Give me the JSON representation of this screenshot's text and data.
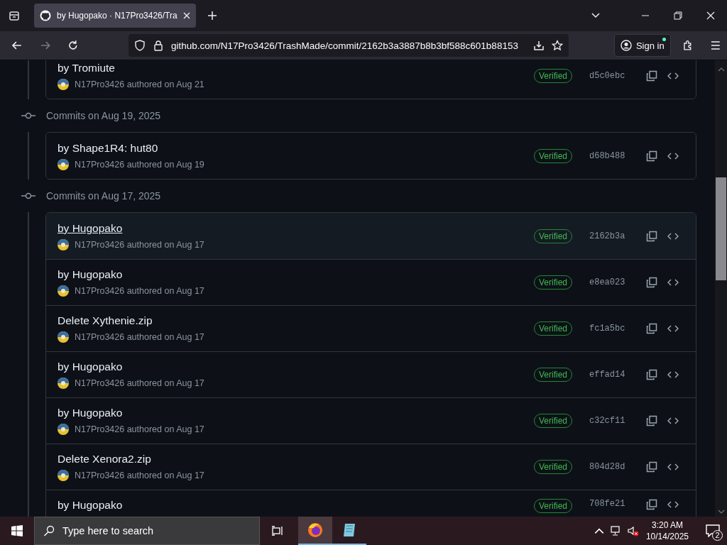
{
  "browser": {
    "tab": {
      "title": "by Hugopako · N17Pro3426/Tra",
      "selected": true
    },
    "address": "github.com/N17Pro3426/TrashMade/commit/2162b3a3887b8b3bf588c601b88153",
    "sign_in": "Sign in"
  },
  "groups": [
    {
      "commits": [
        {
          "title": "by Tromiute",
          "meta": "N17Pro3426 authored on Aug 21",
          "badge": "Verified",
          "sha": "d5c0ebc",
          "selected": false
        }
      ]
    },
    {
      "heading": "Commits on Aug 19, 2025",
      "commits": [
        {
          "title": "by Shape1R4: hut80",
          "meta": "N17Pro3426 authored on Aug 19",
          "badge": "Verified",
          "sha": "d68b488",
          "selected": false
        }
      ]
    },
    {
      "heading": "Commits on Aug 17, 2025",
      "commits": [
        {
          "title": "by Hugopako",
          "meta": "N17Pro3426 authored on Aug 17",
          "badge": "Verified",
          "sha": "2162b3a",
          "selected": true
        },
        {
          "title": "by Hugopako",
          "meta": "N17Pro3426 authored on Aug 17",
          "badge": "Verified",
          "sha": "e8ea023",
          "selected": false
        },
        {
          "title": "Delete Xythenie.zip",
          "meta": "N17Pro3426 authored on Aug 17",
          "badge": "Verified",
          "sha": "fc1a5bc",
          "selected": false
        },
        {
          "title": "by Hugopako",
          "meta": "N17Pro3426 authored on Aug 17",
          "badge": "Verified",
          "sha": "effad14",
          "selected": false
        },
        {
          "title": "by Hugopako",
          "meta": "N17Pro3426 authored on Aug 17",
          "badge": "Verified",
          "sha": "c32cf11",
          "selected": false
        },
        {
          "title": "Delete Xenora2.zip",
          "meta": "N17Pro3426 authored on Aug 17",
          "badge": "Verified",
          "sha": "804d28d",
          "selected": false
        },
        {
          "title": "by Hugopako",
          "badge": "Verified",
          "sha": "708fe21",
          "selected": false
        }
      ]
    }
  ],
  "taskbar": {
    "search_placeholder": "Type here to search",
    "time": "3:20 AM",
    "date": "10/14/2025",
    "notifications": "2"
  }
}
